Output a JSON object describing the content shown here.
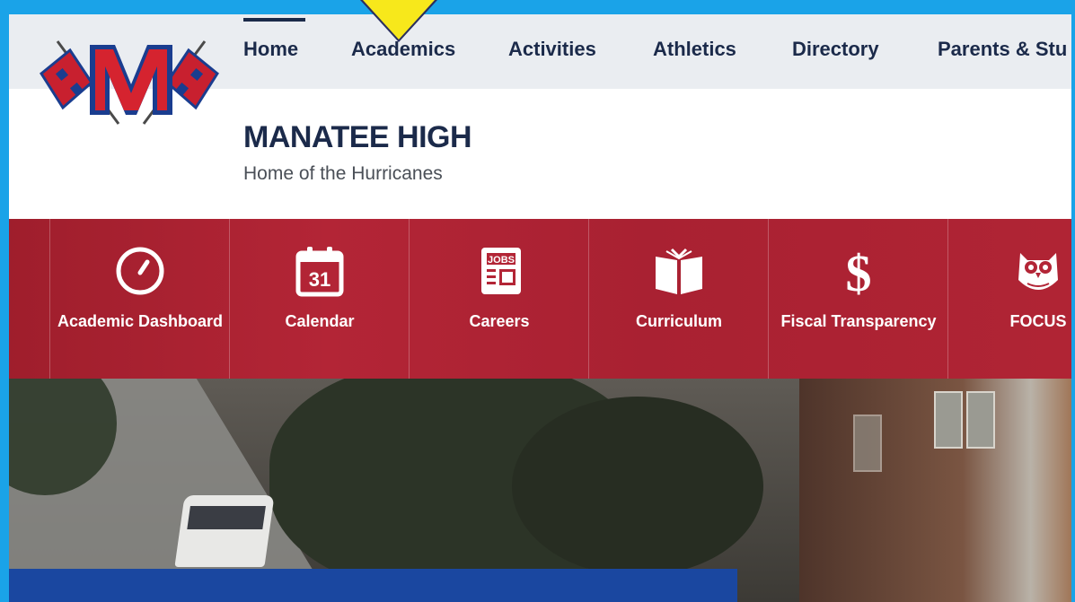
{
  "nav": {
    "items": [
      {
        "label": "Home"
      },
      {
        "label": "Academics"
      },
      {
        "label": "Activities"
      },
      {
        "label": "Athletics"
      },
      {
        "label": "Directory"
      },
      {
        "label": "Parents & Stu"
      }
    ],
    "active": "Home"
  },
  "school": {
    "name": "MANATEE HIGH",
    "tagline": "Home of the Hurricanes"
  },
  "quicklinks": [
    {
      "label": "Academic Dashboard",
      "icon": "gauge-icon"
    },
    {
      "label": "Calendar",
      "icon": "calendar-icon",
      "icon_text": "31"
    },
    {
      "label": "Careers",
      "icon": "jobs-newspaper-icon",
      "icon_text": "JOBS"
    },
    {
      "label": "Curriculum",
      "icon": "open-book-icon"
    },
    {
      "label": "Fiscal Transparency",
      "icon": "dollar-icon",
      "icon_text": "$"
    },
    {
      "label": "FOCUS",
      "icon": "owl-icon"
    }
  ],
  "colors": {
    "nav_text": "#1b2a4a",
    "quicklink_bg": "#b32536",
    "hero_overlay": "#1a47a0",
    "marker": "#f7e81b"
  }
}
